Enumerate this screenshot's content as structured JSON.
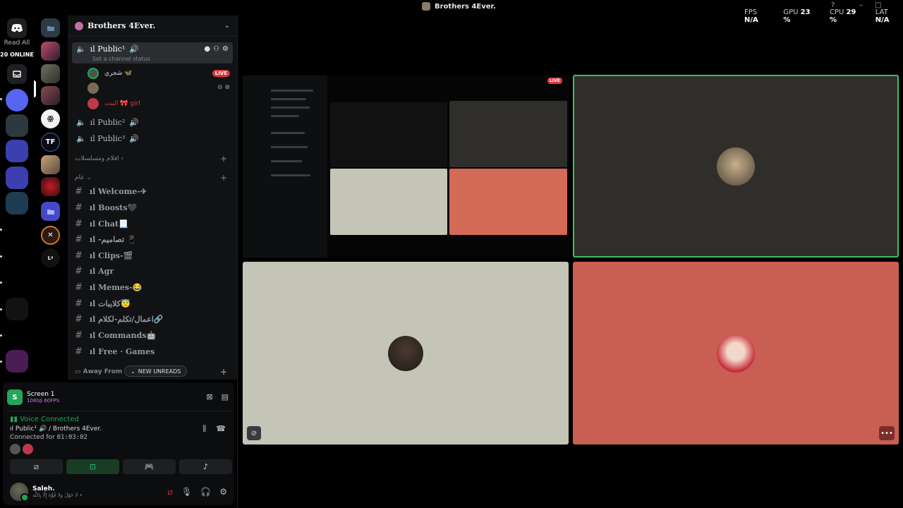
{
  "window": {
    "title": "Brothers 4Ever.",
    "stats": [
      {
        "label": "FPS",
        "value": "N/A"
      },
      {
        "label": "GPU",
        "value": "23 %"
      },
      {
        "label": "CPU",
        "value": "29 %"
      },
      {
        "label": "LAT",
        "value": "N/A"
      }
    ]
  },
  "rail": {
    "read_all": "Read All",
    "online": "20 ONLINE"
  },
  "server": {
    "name": "Brothers 4Ever.",
    "voice_channels": [
      {
        "name": "ıl Public¹",
        "status": "Set a channel status"
      },
      {
        "name": "ıl Public²"
      },
      {
        "name": "ıl Public³"
      }
    ],
    "members": [
      {
        "name": "شجري 🦋",
        "live": "LIVE"
      },
      {
        "name": ""
      },
      {
        "name": "البنت 🎀 girl"
      }
    ],
    "categories": [
      "افلام ومسلسلات",
      "عام"
    ],
    "text_channels": [
      "ıl Welcome-✈",
      "ıl Boosts🖤",
      "ıl Chat📃",
      "ıl -تصاميم 📱",
      "ıl Clips-🎬",
      "ıl Agr",
      "ıl Memes-😂",
      "ıl كلايبات😇",
      "ıl اعمال/تكلم-لكلام🔗",
      "ıl Commands🤖",
      "ıl Free · Games"
    ],
    "away_category": "Away From K",
    "new_unreads": "NEW UNREADS"
  },
  "panel": {
    "screen_title": "Screen 1",
    "screen_sub": "1080p 60FPS",
    "voice_status": "Voice Connected",
    "voice_channel": "ıl Public¹ 🔊 / Brothers 4Ever.",
    "connected_label": "Connected for",
    "connected_time": "01:03:02",
    "user_name": "Saleh.",
    "user_status": "لا حَوْلَ وَلا قُوَّةَ إِلَّا بِاللَّهِ •"
  },
  "tiles": {
    "tile2_color": "#2f2e2a",
    "tile3_color": "#c4c5b6",
    "tile4_color": "#c95e53"
  }
}
